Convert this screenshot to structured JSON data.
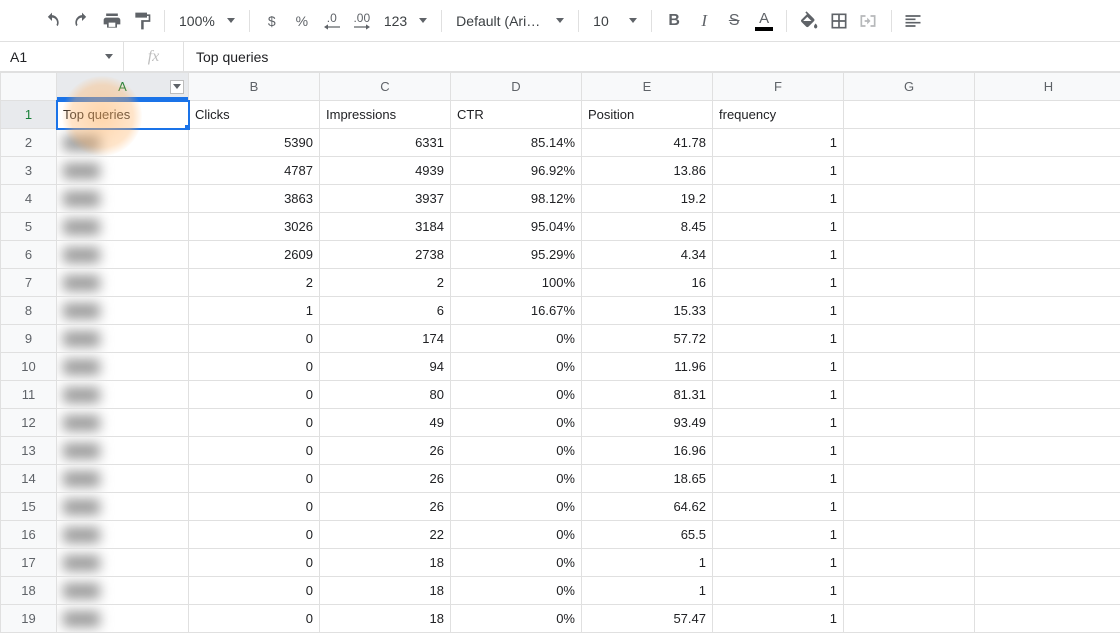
{
  "toolbar": {
    "zoom": "100%",
    "currency": "$",
    "percent": "%",
    "dec_down": ".0",
    "dec_up": ".00",
    "number_format": "123",
    "font": "Default (Ari…",
    "font_size": "10",
    "bold": "B",
    "italic": "I",
    "strike": "S",
    "text_color": "A"
  },
  "formula_bar": {
    "cell_ref": "A1",
    "fx": "fx",
    "value": "Top queries"
  },
  "columns": [
    "A",
    "B",
    "C",
    "D",
    "E",
    "F",
    "G",
    "H"
  ],
  "row_numbers": [
    "1",
    "2",
    "3",
    "4",
    "5",
    "6",
    "7",
    "8",
    "9",
    "10",
    "11",
    "12",
    "13",
    "14",
    "15",
    "16",
    "17",
    "18",
    "19"
  ],
  "headers": {
    "A": "Top queries",
    "B": "Clicks",
    "C": "Impressions",
    "D": "CTR",
    "E": "Position",
    "F": "frequency"
  },
  "rows": [
    {
      "B": "5390",
      "C": "6331",
      "D": "85.14%",
      "E": "41.78",
      "F": "1"
    },
    {
      "B": "4787",
      "C": "4939",
      "D": "96.92%",
      "E": "13.86",
      "F": "1"
    },
    {
      "B": "3863",
      "C": "3937",
      "D": "98.12%",
      "E": "19.2",
      "F": "1"
    },
    {
      "B": "3026",
      "C": "3184",
      "D": "95.04%",
      "E": "8.45",
      "F": "1"
    },
    {
      "B": "2609",
      "C": "2738",
      "D": "95.29%",
      "E": "4.34",
      "F": "1"
    },
    {
      "B": "2",
      "C": "2",
      "D": "100%",
      "E": "16",
      "F": "1"
    },
    {
      "B": "1",
      "C": "6",
      "D": "16.67%",
      "E": "15.33",
      "F": "1"
    },
    {
      "B": "0",
      "C": "174",
      "D": "0%",
      "E": "57.72",
      "F": "1"
    },
    {
      "B": "0",
      "C": "94",
      "D": "0%",
      "E": "11.96",
      "F": "1"
    },
    {
      "B": "0",
      "C": "80",
      "D": "0%",
      "E": "81.31",
      "F": "1"
    },
    {
      "B": "0",
      "C": "49",
      "D": "0%",
      "E": "93.49",
      "F": "1"
    },
    {
      "B": "0",
      "C": "26",
      "D": "0%",
      "E": "16.96",
      "F": "1"
    },
    {
      "B": "0",
      "C": "26",
      "D": "0%",
      "E": "18.65",
      "F": "1"
    },
    {
      "B": "0",
      "C": "26",
      "D": "0%",
      "E": "64.62",
      "F": "1"
    },
    {
      "B": "0",
      "C": "22",
      "D": "0%",
      "E": "65.5",
      "F": "1"
    },
    {
      "B": "0",
      "C": "18",
      "D": "0%",
      "E": "1",
      "F": "1"
    },
    {
      "B": "0",
      "C": "18",
      "D": "0%",
      "E": "1",
      "F": "1"
    },
    {
      "B": "0",
      "C": "18",
      "D": "0%",
      "E": "57.47",
      "F": "1"
    }
  ]
}
